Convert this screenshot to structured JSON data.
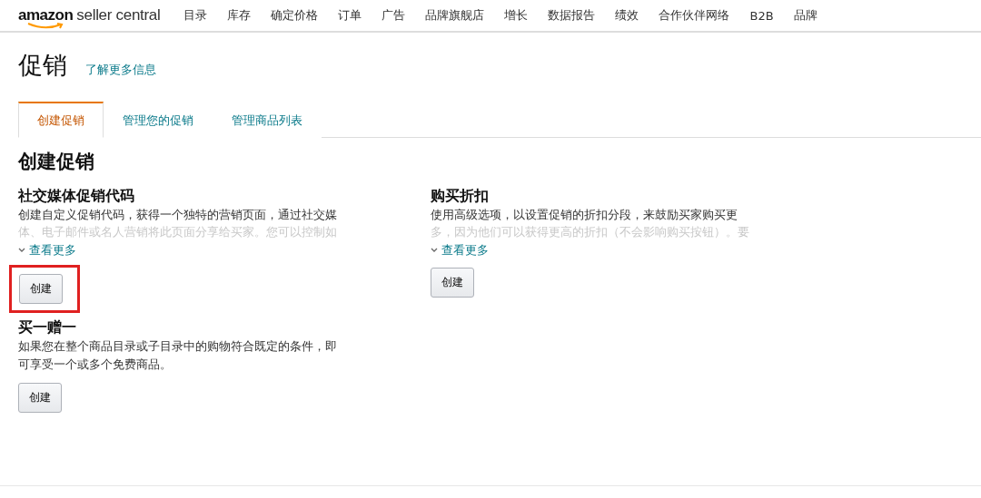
{
  "logo": {
    "brand": "amazon",
    "product": "seller central"
  },
  "nav": [
    "目录",
    "库存",
    "确定价格",
    "订单",
    "广告",
    "品牌旗舰店",
    "增长",
    "数据报告",
    "绩效",
    "合作伙伴网络",
    "B2B",
    "品牌"
  ],
  "page": {
    "title": "促销",
    "learn_more": "了解更多信息"
  },
  "tabs": [
    {
      "label": "创建促销",
      "selected": true
    },
    {
      "label": "管理您的促销",
      "selected": false
    },
    {
      "label": "管理商品列表",
      "selected": false
    }
  ],
  "section_title": "创建促销",
  "cards": [
    {
      "title": "社交媒体促销代码",
      "lines": [
        "创建自定义促销代码，获得一个独特的营销页面，通过社交媒"
      ],
      "faded_line": "体、电子邮件或名人营销将此页面分享给买家。您可以控制如",
      "more": "查看更多",
      "button": "创建",
      "highlighted": true
    },
    {
      "title": "购买折扣",
      "lines": [
        "使用高级选项，以设置促销的折扣分段，来鼓励买家购买更"
      ],
      "faded_line": "多，因为他们可以获得更高的折扣（不会影响购买按钮）。要",
      "more": "查看更多",
      "button": "创建",
      "highlighted": false
    },
    {
      "title": "买一赠一",
      "lines": [
        "如果您在整个商品目录或子目录中的购物符合既定的条件，即",
        "可享受一个或多个免费商品。"
      ],
      "button": "创建",
      "highlighted": false
    }
  ]
}
